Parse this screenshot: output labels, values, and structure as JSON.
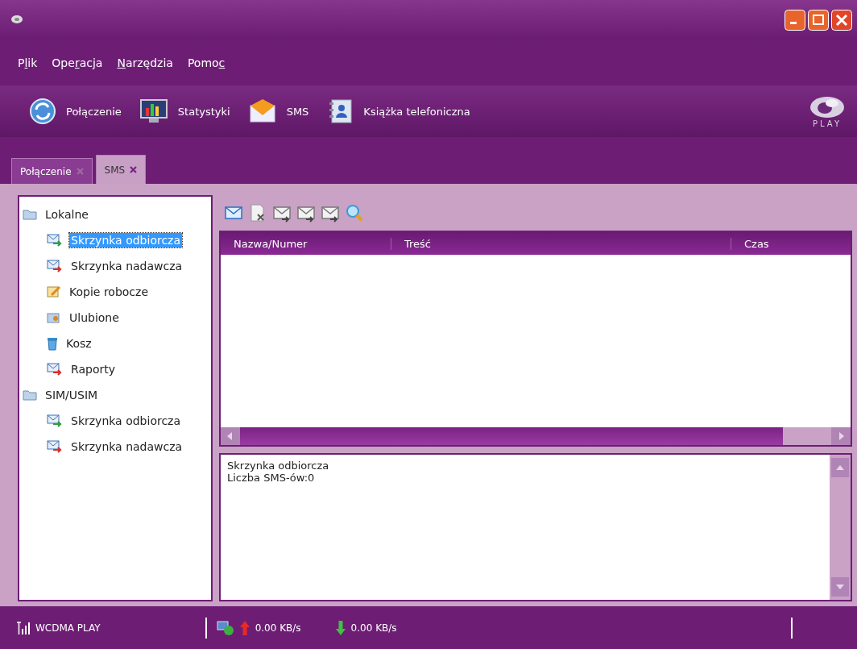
{
  "menu": [
    {
      "before": "P",
      "key": "l",
      "after": "ik"
    },
    {
      "before": "Ope",
      "key": "r",
      "after": "acja"
    },
    {
      "key": "N",
      "after": "arzędzia"
    },
    {
      "before": "Pomo",
      "key": "c"
    }
  ],
  "toolbar": [
    {
      "label": "Połączenie",
      "kind": "connection"
    },
    {
      "label": "Statystyki",
      "kind": "stats"
    },
    {
      "label": "SMS",
      "kind": "sms"
    },
    {
      "label": "Książka telefoniczna",
      "kind": "contacts"
    }
  ],
  "logo": {
    "text": "PLAY"
  },
  "tabs": [
    {
      "label": "Połączenie",
      "selected": false
    },
    {
      "label": "SMS",
      "selected": true
    }
  ],
  "tree": [
    {
      "label": "Lokalne",
      "kind": "folder",
      "selected": false,
      "children": [
        {
          "label": "Skrzynka odbiorcza",
          "kind": "inbox",
          "selected": true
        },
        {
          "label": "Skrzynka nadawcza",
          "kind": "outbox",
          "selected": false
        },
        {
          "label": "Kopie robocze",
          "kind": "drafts",
          "selected": false
        },
        {
          "label": "Ulubione",
          "kind": "favorites",
          "selected": false
        },
        {
          "label": "Kosz",
          "kind": "trash",
          "selected": false
        },
        {
          "label": "Raporty",
          "kind": "reports",
          "selected": false
        }
      ]
    },
    {
      "label": "SIM/USIM",
      "kind": "folder",
      "selected": false,
      "children": [
        {
          "label": "Skrzynka odbiorcza",
          "kind": "inbox",
          "selected": false
        },
        {
          "label": "Skrzynka nadawcza",
          "kind": "outbox",
          "selected": false
        }
      ]
    }
  ],
  "table": {
    "columns": [
      "Nazwa/Numer",
      "Treść",
      "Czas"
    ]
  },
  "details": [
    "Skrzynka odbiorcza",
    "Liczba SMS-ów:0"
  ],
  "status_bar": {
    "network": "WCDMA PLAY",
    "upload": "0.00 KB/s",
    "download": "0.00 KB/s"
  }
}
